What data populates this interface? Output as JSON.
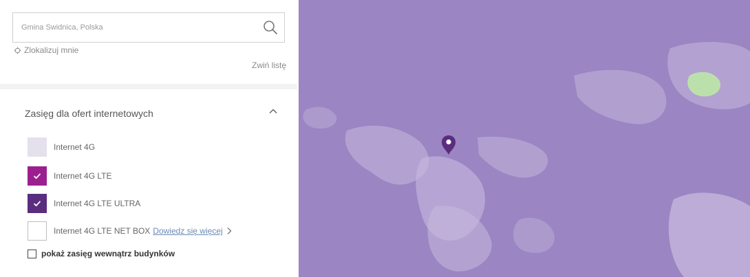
{
  "search": {
    "placeholder": "Gmina Świdnica, Polska"
  },
  "locate": {
    "label": "Zlokalizuj mnie"
  },
  "collapse": {
    "label": "Zwiń listę"
  },
  "coverage_section": {
    "title": "Zasięg dla ofert internetowych",
    "layers": [
      {
        "label": "Internet 4G",
        "checked": false,
        "color": "#e4e0ec"
      },
      {
        "label": "Internet 4G LTE",
        "checked": true,
        "color": "#9c1f8f"
      },
      {
        "label": "Internet 4G LTE ULTRA",
        "checked": true,
        "color": "#5a2d7f"
      },
      {
        "label": "Internet 4G LTE NET BOX",
        "checked": false,
        "color": "#ffffff",
        "link": "Dowiedz się więcej"
      }
    ],
    "indoor": {
      "label": "pokaż zasięg wewnątrz budynków",
      "checked": false
    }
  },
  "map": {
    "base_color": "#9b85c2",
    "light_color": "#cfc3e4",
    "highlight_color": "#bde7a6",
    "pin_color": "#5a2d7f"
  }
}
